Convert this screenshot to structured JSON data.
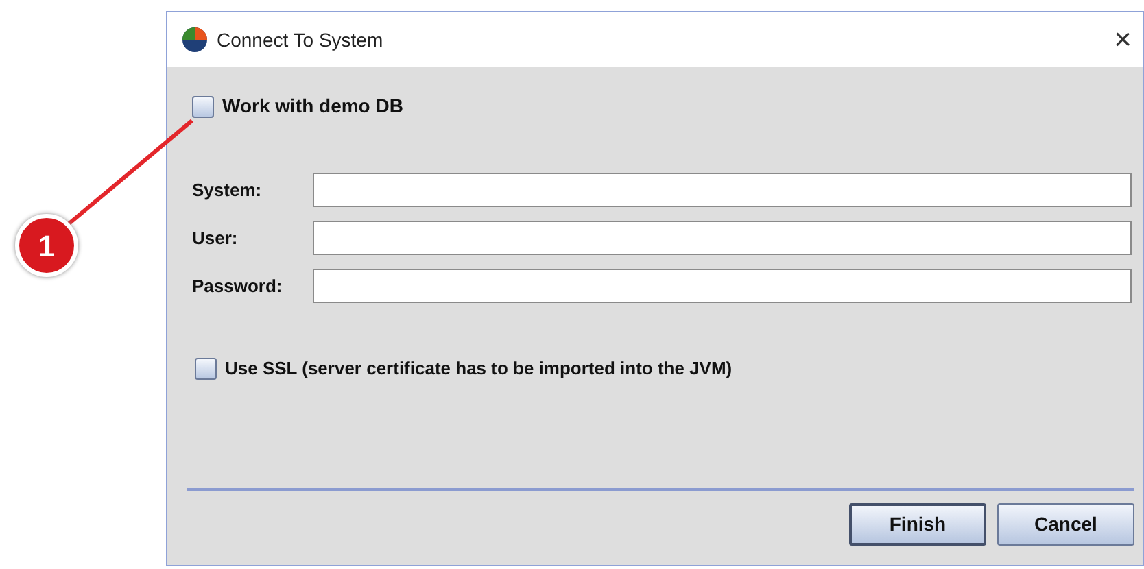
{
  "window": {
    "title": "Connect To System",
    "close": "×"
  },
  "demo_checkbox": {
    "label": "Work with demo DB",
    "checked": false
  },
  "fields": [
    {
      "label": "System:"
    },
    {
      "label": "User:"
    },
    {
      "label": "Password:"
    }
  ],
  "ssl_checkbox": {
    "label": "Use SSL (server certificate has to be imported into the JVM)",
    "checked": false
  },
  "buttons": [
    {
      "label": "Finish",
      "selected": true
    },
    {
      "label": "Cancel",
      "selected": false
    }
  ],
  "callout": {
    "number": "1"
  }
}
